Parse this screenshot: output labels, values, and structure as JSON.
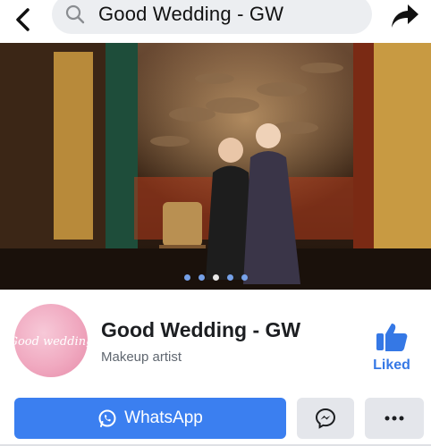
{
  "topbar": {
    "search_text": "Good Wedding - GW",
    "back_icon": "chevron-left-icon",
    "search_icon": "search-icon",
    "share_icon": "share-arrow-icon"
  },
  "cover": {
    "photo": "two women in qipao inside a temple with hanging incense coils",
    "dots_total": 5,
    "dots_active_index": 2
  },
  "profile": {
    "name": "Good Wedding - GW",
    "category": "Makeup artist",
    "avatar_logo_text": "Good wedding",
    "liked_label": "Liked"
  },
  "actions": {
    "whatsapp_label": "WhatsApp",
    "whatsapp_icon": "whatsapp-icon",
    "messenger_icon": "messenger-icon",
    "more_icon": "more-dots-icon"
  },
  "colors": {
    "primary_blue": "#3b7ff0",
    "liked_blue": "#3578e5",
    "button_gray": "#e4e6eb",
    "search_bg": "#eceef1"
  }
}
